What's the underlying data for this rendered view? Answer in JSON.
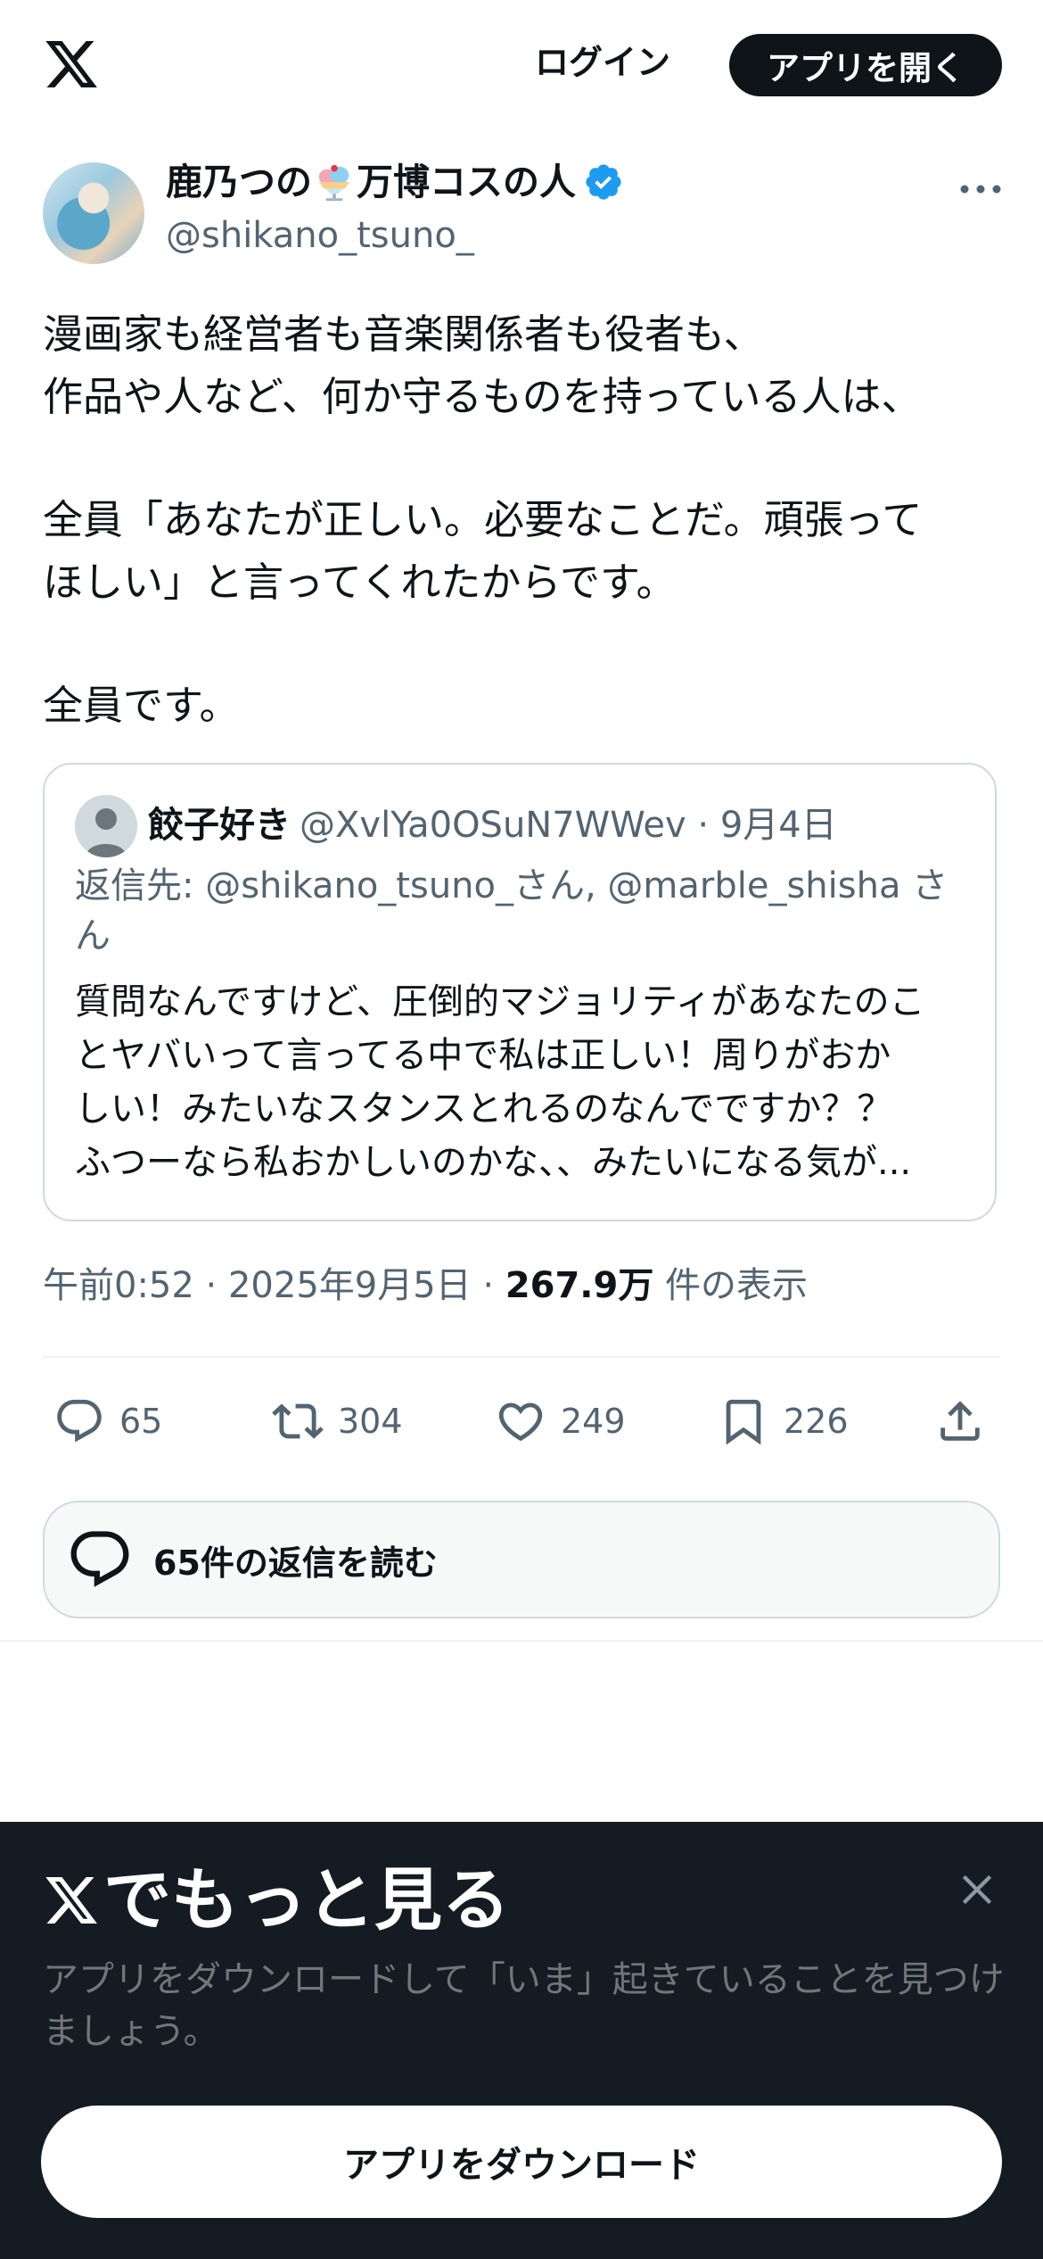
{
  "header": {
    "login_label": "ログイン",
    "open_app_label": "アプリを開く"
  },
  "author": {
    "name_part1": "鹿乃つの",
    "name_part2": "万博コスの人",
    "handle": "@shikano_tsuno_"
  },
  "tweet": {
    "lines": [
      "漫画家も経営者も音楽関係者も役者も、",
      "作品や人など、何か守るものを持っている人は、",
      "",
      "全員「あなたが正しい。必要なことだ。頑張って",
      "ほしい」と言ってくれたからです。",
      "",
      "全員です。"
    ],
    "timestamp_prefix": "午前0:52 · 2025年9月5日 · ",
    "views_count": "267.9万",
    "views_label": " 件の表示"
  },
  "quote": {
    "name": "餃子好き",
    "meta": "@XvlYa0OSuN7WWev · 9月4日",
    "reply_to": "返信先: @shikano_tsuno_さん, @marble_shisha さん",
    "lines": [
      "質問なんですけど、圧倒的マジョリティがあなたのこ",
      "とヤバいって言ってる中で私は正しい！周りがおか",
      "しい！みたいなスタンスとれるのなんでですか？？",
      "ふつーなら私おかしいのかな、、みたいになる気が..."
    ]
  },
  "actions": {
    "replies": "65",
    "retweets": "304",
    "likes": "249",
    "bookmarks": "226"
  },
  "read_replies_label": "65件の返信を読む",
  "banner": {
    "title": "でもっと見る",
    "description": "アプリをダウンロードして「いま」起きていることを見つけましょう。",
    "download_label": "アプリをダウンロード"
  },
  "colors": {
    "text_primary": "#0f1419",
    "text_secondary": "#536471",
    "verified_blue": "#1d9bf0",
    "banner_bg": "#141b23",
    "border": "#cfd9de"
  },
  "icons": [
    "x-logo-icon",
    "parfait-emoji-icon",
    "verified-badge-icon",
    "more-icon",
    "reply-icon",
    "retweet-icon",
    "like-icon",
    "bookmark-icon",
    "share-icon",
    "replies-bubble-icon",
    "close-icon"
  ]
}
